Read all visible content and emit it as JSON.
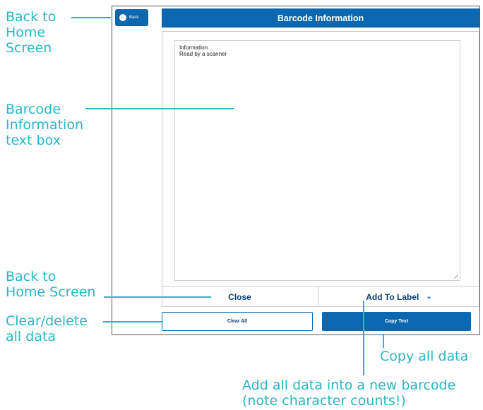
{
  "app": {
    "back_label": "Back",
    "header_title": "Barcode Information",
    "textbox_lines": [
      "Information",
      "Read by a scanner"
    ],
    "close_label": "Close",
    "add_to_label_label": "Add To Label",
    "clear_all_label": "Clear All",
    "copy_text_label": "Copy Text",
    "icons": {
      "back": "arrow-left-circle-icon",
      "dropdown": "chevron-down-icon",
      "resize": "resize-grip-icon"
    }
  },
  "annotations": {
    "back_to_home": [
      "Back to",
      "Home",
      "Screen"
    ],
    "textbox_info": [
      "Barcode",
      "Information",
      "text box"
    ],
    "back_to_home_2": [
      "Back to",
      "Home Screen"
    ],
    "clear_delete": [
      "Clear/delete",
      "all data"
    ],
    "copy_all": [
      "Copy all data"
    ],
    "add_all": [
      "Add all data into a new barcode",
      "(note character counts!)"
    ]
  },
  "colors": {
    "primary": "#0a67b0",
    "annotation": "#29b6c6"
  }
}
